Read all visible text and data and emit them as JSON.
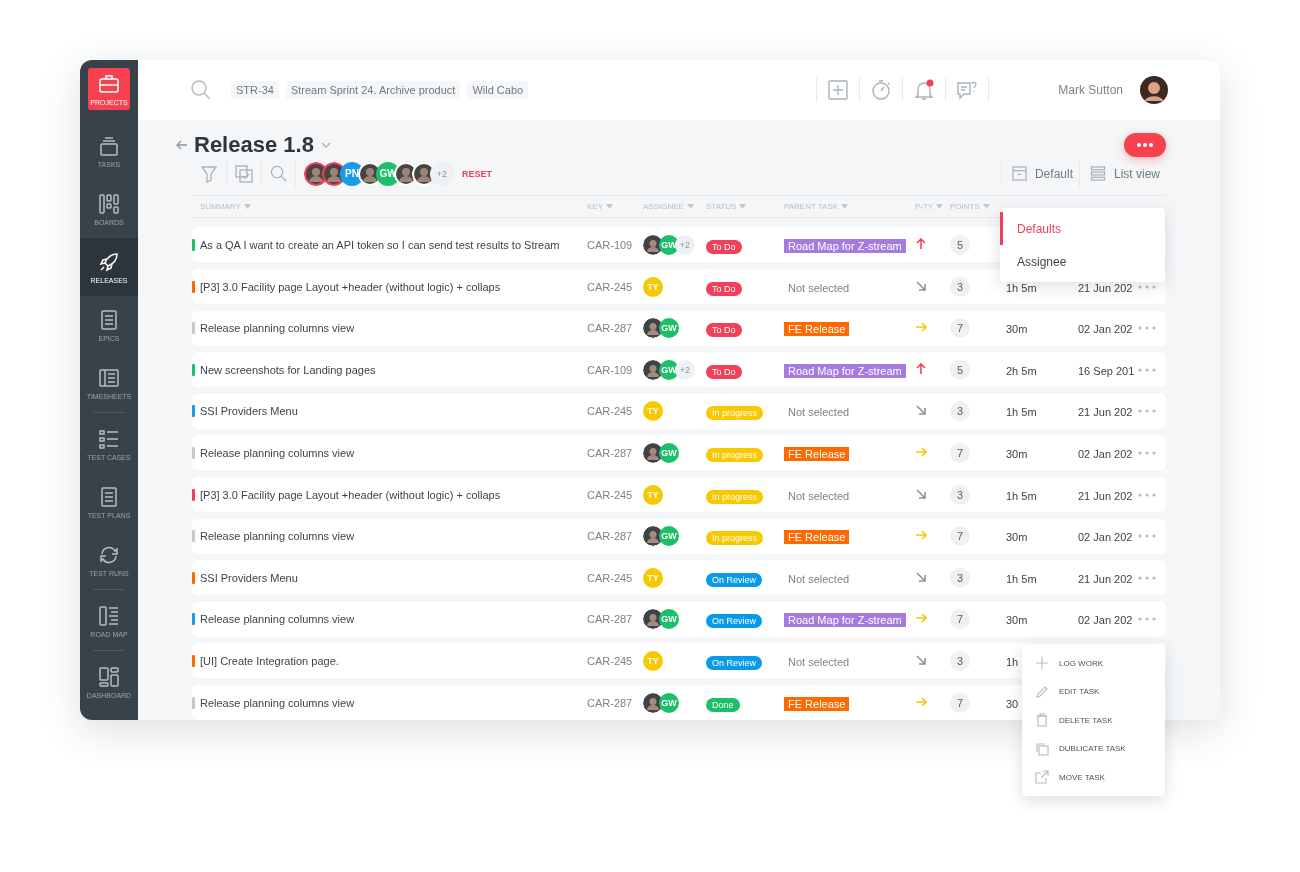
{
  "sidebar": {
    "items": [
      {
        "label": "PROJECTS",
        "kind": "projects",
        "selected": false,
        "divider_after": false
      },
      {
        "label": "TASKS",
        "kind": "tasks",
        "selected": false,
        "divider_after": false
      },
      {
        "label": "BOARDS",
        "kind": "boards",
        "selected": false,
        "divider_after": false
      },
      {
        "label": "RELEASES",
        "kind": "releases",
        "selected": true,
        "divider_after": false
      },
      {
        "label": "EPICS",
        "kind": "epics",
        "selected": false,
        "divider_after": false
      },
      {
        "label": "TIMESHEETS",
        "kind": "timesheets",
        "selected": false,
        "divider_after": true
      },
      {
        "label": "TEST CASES",
        "kind": "testcases",
        "selected": false,
        "divider_after": false
      },
      {
        "label": "TEST PLANS",
        "kind": "testplans",
        "selected": false,
        "divider_after": false
      },
      {
        "label": "TEST RUNS",
        "kind": "testruns",
        "selected": false,
        "divider_after": true
      },
      {
        "label": "ROAD MAP",
        "kind": "roadmap",
        "selected": false,
        "divider_after": true
      },
      {
        "label": "DASHBOARD",
        "kind": "dashboard",
        "selected": false,
        "divider_after": false
      }
    ]
  },
  "header": {
    "chips": [
      "STR-34",
      "Stream Sprint 24. Archive product",
      "Wild Cabo"
    ],
    "icons": [
      {
        "kind": "plus",
        "badge": false
      },
      {
        "kind": "timer",
        "badge": false
      },
      {
        "kind": "bell",
        "badge": true
      },
      {
        "kind": "help",
        "badge": false
      }
    ],
    "user": "Mark Sutton"
  },
  "title": "Release 1.8",
  "filter": {
    "avatars": [
      {
        "kind": "photo",
        "selected": true
      },
      {
        "kind": "photo",
        "selected": true
      },
      {
        "kind": "initials",
        "initials": "PN",
        "color": "#1a9be6",
        "selected": false
      },
      {
        "kind": "photo",
        "selected": false
      },
      {
        "kind": "initials",
        "initials": "GW",
        "color": "#1cc06a",
        "selected": false
      },
      {
        "kind": "photo",
        "selected": false
      },
      {
        "kind": "photo",
        "selected": false
      }
    ],
    "extra": "+2",
    "reset": "RESET"
  },
  "view": {
    "group": "Default",
    "mode": "List view"
  },
  "columns": [
    "SUMMARY",
    "KEY",
    "ASSIGNEE",
    "STATUS",
    "PARENT TASK",
    "P-TY",
    "POINTS"
  ],
  "rows": [
    {
      "color": "#1cc06a",
      "summary": "As a QA I want to create an API token so I can send test results to Stream",
      "key": "CAR-109",
      "assignees": [
        {
          "kind": "photo"
        },
        {
          "kind": "initials",
          "initials": "GW",
          "color": "#1cc06a"
        }
      ],
      "extra": "+2",
      "status": {
        "label": "To Do",
        "kind": "todo"
      },
      "parent": {
        "label": "Road Map for Z-stream",
        "kind": "roadmap"
      },
      "priority": {
        "kind": "high"
      },
      "points": "5"
    },
    {
      "color": "#ff6a00",
      "summary": "[P3] 3.0 Facility page Layout +header (without logic) + collaps",
      "key": "CAR-245",
      "assignees": [
        {
          "kind": "initials",
          "initials": "TY",
          "color": "#f8c800"
        }
      ],
      "status": {
        "label": "To Do",
        "kind": "todo"
      },
      "parent": {
        "label": "Not selected",
        "kind": "none"
      },
      "priority": {
        "kind": "low"
      },
      "points": "3",
      "time": "1h 5m",
      "date": "21 Jun 202"
    },
    {
      "color": "#c4c9ce",
      "summary": "Release planning columns view",
      "key": "CAR-287",
      "assignees": [
        {
          "kind": "photo"
        },
        {
          "kind": "initials",
          "initials": "GW",
          "color": "#1cc06a"
        }
      ],
      "status": {
        "label": "To Do",
        "kind": "todo"
      },
      "parent": {
        "label": "FE Release",
        "kind": "fe"
      },
      "priority": {
        "kind": "medium"
      },
      "points": "7",
      "time": "30m",
      "date": "02 Jan 202"
    },
    {
      "color": "#1cc06a",
      "summary": "New screenshots for Landing pages",
      "key": "CAR-109",
      "assignees": [
        {
          "kind": "photo"
        },
        {
          "kind": "initials",
          "initials": "GW",
          "color": "#1cc06a"
        }
      ],
      "extra": "+2",
      "status": {
        "label": "To Do",
        "kind": "todo"
      },
      "parent": {
        "label": "Road Map for Z-stream",
        "kind": "roadmap"
      },
      "priority": {
        "kind": "high"
      },
      "points": "5",
      "time": "2h 5m",
      "date": "16 Sep 201"
    },
    {
      "color": "#1a9be6",
      "summary": "SSI Providers Menu",
      "key": "CAR-245",
      "assignees": [
        {
          "kind": "initials",
          "initials": "TY",
          "color": "#f8c800"
        }
      ],
      "status": {
        "label": "In progress",
        "kind": "progress"
      },
      "parent": {
        "label": "Not selected",
        "kind": "none"
      },
      "priority": {
        "kind": "low"
      },
      "points": "3",
      "time": "1h 5m",
      "date": "21 Jun 202"
    },
    {
      "color": "#c4c9ce",
      "summary": "Release planning columns view",
      "key": "CAR-287",
      "assignees": [
        {
          "kind": "photo"
        },
        {
          "kind": "initials",
          "initials": "GW",
          "color": "#1cc06a"
        }
      ],
      "status": {
        "label": "In progress",
        "kind": "progress"
      },
      "parent": {
        "label": "FE Release",
        "kind": "fe"
      },
      "priority": {
        "kind": "medium"
      },
      "points": "7",
      "time": "30m",
      "date": "02 Jan 202"
    },
    {
      "color": "#f0405a",
      "summary": "[P3] 3.0 Facility page Layout +header (without logic) + collaps",
      "key": "CAR-245",
      "assignees": [
        {
          "kind": "initials",
          "initials": "TY",
          "color": "#f8c800"
        }
      ],
      "status": {
        "label": "In progress",
        "kind": "progress"
      },
      "parent": {
        "label": "Not selected",
        "kind": "none"
      },
      "priority": {
        "kind": "low"
      },
      "points": "3",
      "time": "1h 5m",
      "date": "21 Jun 202"
    },
    {
      "color": "#c4c9ce",
      "summary": "Release planning columns view",
      "key": "CAR-287",
      "assignees": [
        {
          "kind": "photo"
        },
        {
          "kind": "initials",
          "initials": "GW",
          "color": "#1cc06a"
        }
      ],
      "status": {
        "label": "In progress",
        "kind": "progress"
      },
      "parent": {
        "label": "FE Release",
        "kind": "fe"
      },
      "priority": {
        "kind": "medium"
      },
      "points": "7",
      "time": "30m",
      "date": "02 Jan 202"
    },
    {
      "color": "#ff6a00",
      "summary": "SSI Providers Menu",
      "key": "CAR-245",
      "assignees": [
        {
          "kind": "initials",
          "initials": "TY",
          "color": "#f8c800"
        }
      ],
      "status": {
        "label": "On Review",
        "kind": "review"
      },
      "parent": {
        "label": "Not selected",
        "kind": "none"
      },
      "priority": {
        "kind": "low"
      },
      "points": "3",
      "time": "1h 5m",
      "date": "21 Jun 202"
    },
    {
      "color": "#1a9be6",
      "summary": "Release planning columns view",
      "key": "CAR-287",
      "assignees": [
        {
          "kind": "photo"
        },
        {
          "kind": "initials",
          "initials": "GW",
          "color": "#1cc06a"
        }
      ],
      "status": {
        "label": "On Review",
        "kind": "review"
      },
      "parent": {
        "label": "Road Map for Z-stream",
        "kind": "roadmap"
      },
      "priority": {
        "kind": "medium"
      },
      "points": "7",
      "time": "30m",
      "date": "02 Jan 202"
    },
    {
      "color": "#ff6a00",
      "summary": "[UI] Create Integration page.",
      "key": "CAR-245",
      "assignees": [
        {
          "kind": "initials",
          "initials": "TY",
          "color": "#f8c800"
        }
      ],
      "status": {
        "label": "On Review",
        "kind": "review"
      },
      "parent": {
        "label": "Not selected",
        "kind": "none"
      },
      "priority": {
        "kind": "low"
      },
      "points": "3",
      "time": "1h"
    },
    {
      "color": "#c4c9ce",
      "summary": "Release planning columns view",
      "key": "CAR-287",
      "assignees": [
        {
          "kind": "photo"
        },
        {
          "kind": "initials",
          "initials": "GW",
          "color": "#1cc06a"
        }
      ],
      "status": {
        "label": "Done",
        "kind": "done"
      },
      "parent": {
        "label": "FE Release",
        "kind": "fe"
      },
      "priority": {
        "kind": "medium"
      },
      "points": "7",
      "time": "30"
    }
  ],
  "group_menu": [
    {
      "label": "Defaults",
      "selected": true
    },
    {
      "label": "Assignee",
      "selected": false
    }
  ],
  "context_menu": [
    {
      "label": "LOG WORK",
      "kind": "plus"
    },
    {
      "label": "EDIT TASK",
      "kind": "pencil"
    },
    {
      "label": "DELETE TASK",
      "kind": "trash"
    },
    {
      "label": "DUBLICATE TASK",
      "kind": "copy"
    },
    {
      "label": "MOVE TASK",
      "kind": "external"
    }
  ]
}
